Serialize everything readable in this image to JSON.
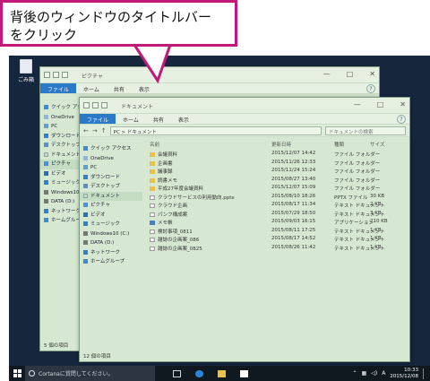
{
  "callout": {
    "line1": "背後のウィンドウのタイトルバー",
    "line2": "をクリック"
  },
  "desktop": {
    "recycle_bin_label": "ごみ箱"
  },
  "back_window": {
    "title": "ピクチャ",
    "tabs": [
      "ファイル",
      "ホーム",
      "共有",
      "表示"
    ],
    "nav": [
      "クイック アクセス",
      "OneDrive",
      "PC",
      "ダウンロード",
      "デスクトップ",
      "ドキュメント",
      "ピクチャ",
      "ビデオ",
      "ミュージック",
      "Windows10 (C:)",
      "DATA (D:)",
      "ネットワーク",
      "ホームグループ"
    ],
    "status": "5 個の項目"
  },
  "front_window": {
    "title": "ドキュメント",
    "tabs": [
      "ファイル",
      "ホーム",
      "共有",
      "表示"
    ],
    "address": "PC > ドキュメント",
    "search_placeholder": "ドキュメントの検索",
    "nav": [
      "クイック アクセス",
      "OneDrive",
      "PC",
      "ダウンロード",
      "デスクトップ",
      "ドキュメント",
      "ピクチャ",
      "ビデオ",
      "ミュージック",
      "Windows10 (C:)",
      "DATA (D:)",
      "ネットワーク",
      "ホームグループ"
    ],
    "columns": {
      "name": "名前",
      "date": "更新日時",
      "type": "種類",
      "size": "サイズ"
    },
    "files": [
      {
        "name": "会議資料",
        "date": "2015/12/07 14:42",
        "type": "ファイル フォルダー",
        "size": "",
        "icon": "folder"
      },
      {
        "name": "企画書",
        "date": "2015/11/26 12:33",
        "type": "ファイル フォルダー",
        "size": "",
        "icon": "folder"
      },
      {
        "name": "議事録",
        "date": "2015/11/24 15:24",
        "type": "ファイル フォルダー",
        "size": "",
        "icon": "folder"
      },
      {
        "name": "読書メモ",
        "date": "2015/08/27 13:40",
        "type": "ファイル フォルダー",
        "size": "",
        "icon": "folder"
      },
      {
        "name": "平成27年度会議資料",
        "date": "2015/12/07 15:09",
        "type": "ファイル フォルダー",
        "size": "",
        "icon": "folder"
      },
      {
        "name": "クラウドサービスの利用動向.pptx",
        "date": "2015/08/10 18:26",
        "type": "PPTX ファイル",
        "size": "30 KB",
        "icon": "file"
      },
      {
        "name": "クラウド企画",
        "date": "2015/08/17 11:34",
        "type": "テキスト ドキュメント",
        "size": "2 KB",
        "icon": "file"
      },
      {
        "name": "パンフ構成案",
        "date": "2015/07/29 18:50",
        "type": "テキスト ドキュメント",
        "size": "3 KB",
        "icon": "file"
      },
      {
        "name": "メモ帳",
        "date": "2015/09/03 16:15",
        "type": "アプリケーション",
        "size": "210 KB",
        "icon": "app"
      },
      {
        "name": "検討事項_0811",
        "date": "2015/08/11 17:25",
        "type": "テキスト ドキュメント",
        "size": "1 KB",
        "icon": "file"
      },
      {
        "name": "雑誌の企画案_086",
        "date": "2015/08/17 14:52",
        "type": "テキスト ドキュメント",
        "size": "1 KB",
        "icon": "file"
      },
      {
        "name": "雑誌の企画案_0825",
        "date": "2015/08/26 11:42",
        "type": "テキスト ドキュメント",
        "size": "1 KB",
        "icon": "file"
      }
    ],
    "status": "12 個の項目"
  },
  "taskbar": {
    "cortana_text": "Cortanaに質問してください。",
    "ime": "A",
    "time": "10:33",
    "date": "2015/12/08"
  }
}
